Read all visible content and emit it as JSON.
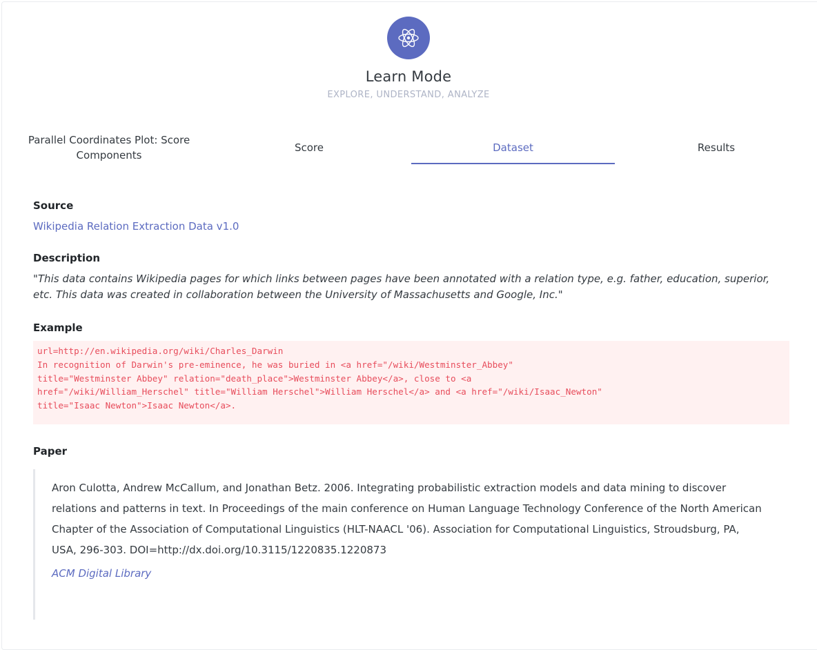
{
  "app": {
    "title": "Learn Mode",
    "subtitle": "EXPLORE, UNDERSTAND, ANALYZE",
    "logo_icon": "atom-icon",
    "accent_color": "#5c6bc0"
  },
  "tabs": [
    {
      "label": "Parallel Coordinates Plot: Score Components",
      "active": false
    },
    {
      "label": "Score",
      "active": false
    },
    {
      "label": "Dataset",
      "active": true
    },
    {
      "label": "Results",
      "active": false
    }
  ],
  "source": {
    "heading": "Source",
    "link_text": "Wikipedia Relation Extraction Data v1.0"
  },
  "description": {
    "heading": "Description",
    "text": "\"This data contains Wikipedia pages for which links between pages have been annotated with a relation type, e.g. father, education, superior, etc. This data was created in collaboration between the University of Massachusetts and Google, Inc.\""
  },
  "example": {
    "heading": "Example",
    "code": "url=http://en.wikipedia.org/wiki/Charles_Darwin\nIn recognition of Darwin's pre-eminence, he was buried in <a href=\"/wiki/Westminster_Abbey\"\ntitle=\"Westminster Abbey\" relation=\"death_place\">Westminster Abbey</a>, close to <a\nhref=\"/wiki/William_Herschel\" title=\"William Herschel\">William Herschel</a> and <a href=\"/wiki/Isaac_Newton\"\ntitle=\"Isaac Newton\">Isaac Newton</a>."
  },
  "paper": {
    "heading": "Paper",
    "citation": "Aron Culotta, Andrew McCallum, and Jonathan Betz. 2006. Integrating probabilistic extraction models and data mining to discover relations and patterns in text. In Proceedings of the main conference on Human Language Technology Conference of the North American Chapter of the Association of Computational Linguistics (HLT-NAACL '06). Association for Computational Linguistics, Stroudsburg, PA, USA, 296-303. DOI=http://dx.doi.org/10.3115/1220835.1220873",
    "link_text": "ACM Digital Library"
  }
}
